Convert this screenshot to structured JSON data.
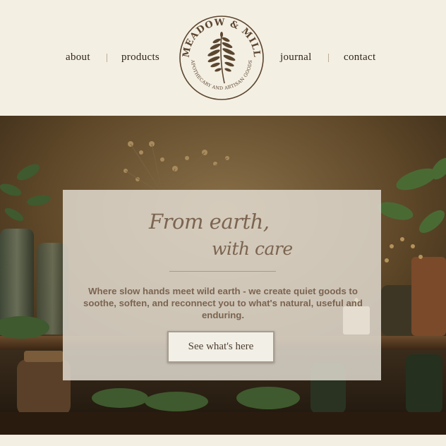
{
  "nav": {
    "left": [
      {
        "label": "about"
      },
      {
        "label": "products"
      }
    ],
    "right": [
      {
        "label": "journal"
      },
      {
        "label": "contact"
      }
    ]
  },
  "brand": {
    "name": "MEADOW & MILL",
    "subtitle": "APOTHECARY AND ARTISAN GOODS",
    "icon": "fern-leaf-icon"
  },
  "hero": {
    "headline_line1": "From earth,",
    "headline_line2": "with care",
    "tagline": "Where slow hands meet wild earth - we create quiet goods to soothe, soften, and reconnect you to what's natural, useful and enduring.",
    "cta_label": "See what's here"
  },
  "colors": {
    "page_bg": "#f4efe3",
    "text_dark": "#2f2418",
    "accent_brown": "#7b6450",
    "logo_brown": "#5b4630"
  }
}
